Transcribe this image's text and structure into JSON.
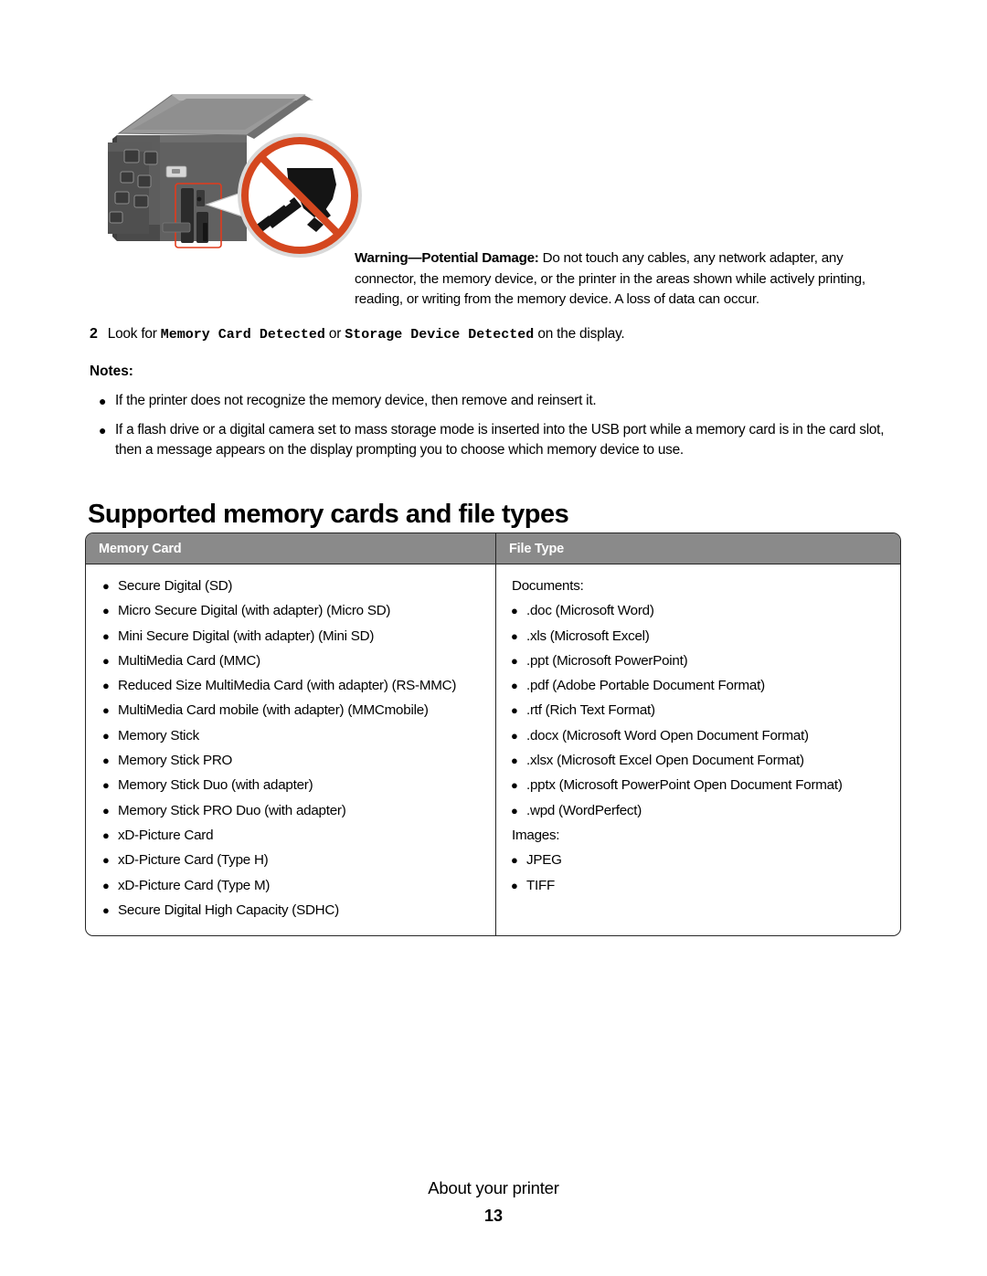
{
  "illustration": {
    "alt_name": "printer-memory-card-slot-no-touch-diagram",
    "prohibition_color": "#d4471f",
    "highlight_color": "#e23b1c",
    "printer_body_color": "#5a5a5a",
    "printer_top_color": "#9a9a9a"
  },
  "warning": {
    "label": "Warning—Potential Damage:",
    "body": " Do not touch any cables, any network adapter, any connector, the memory device, or the printer in the areas shown while actively printing, reading, or writing from the memory device. A loss of data can occur."
  },
  "step": {
    "number": "2",
    "text_before": "Look for ",
    "mono_1": "Memory Card Detected",
    "text_middle": " or ",
    "mono_2": "Storage Device Detected",
    "text_after": " on the display."
  },
  "notes": {
    "title": "Notes:",
    "items": [
      "If the printer does not recognize the memory device, then remove and reinsert it.",
      "If a flash drive or a digital camera set to mass storage mode is inserted into the USB port while a memory card is in the card slot, then a message appears on the display prompting you to choose which memory device to use."
    ]
  },
  "section": {
    "heading": "Supported memory cards and file types"
  },
  "table": {
    "headers": {
      "memory_card": "Memory Card",
      "file_type": "File Type"
    },
    "memory_cards": [
      "Secure Digital (SD)",
      "Micro Secure Digital (with adapter) (Micro SD)",
      "Mini Secure Digital (with adapter) (Mini SD)",
      "MultiMedia Card (MMC)",
      "Reduced Size MultiMedia Card (with adapter) (RS-MMC)",
      "MultiMedia Card mobile (with adapter) (MMCmobile)",
      "Memory Stick",
      "Memory Stick PRO",
      "Memory Stick Duo (with adapter)",
      "Memory Stick PRO Duo (with adapter)",
      "xD-Picture Card",
      "xD-Picture Card (Type H)",
      "xD-Picture Card (Type M)",
      "Secure Digital High Capacity (SDHC)"
    ],
    "file_types": {
      "documents_label": "Documents:",
      "documents": [
        ".doc (Microsoft Word)",
        ".xls (Microsoft Excel)",
        ".ppt (Microsoft PowerPoint)",
        ".pdf (Adobe Portable Document Format)",
        ".rtf (Rich Text Format)",
        ".docx (Microsoft Word Open Document Format)",
        ".xlsx (Microsoft Excel Open Document Format)",
        ".pptx (Microsoft PowerPoint Open Document Format)",
        ".wpd (WordPerfect)"
      ],
      "images_label": "Images:",
      "images": [
        "JPEG",
        "TIFF"
      ]
    }
  },
  "footer": {
    "chapter": "About your printer",
    "page_number": "13"
  }
}
